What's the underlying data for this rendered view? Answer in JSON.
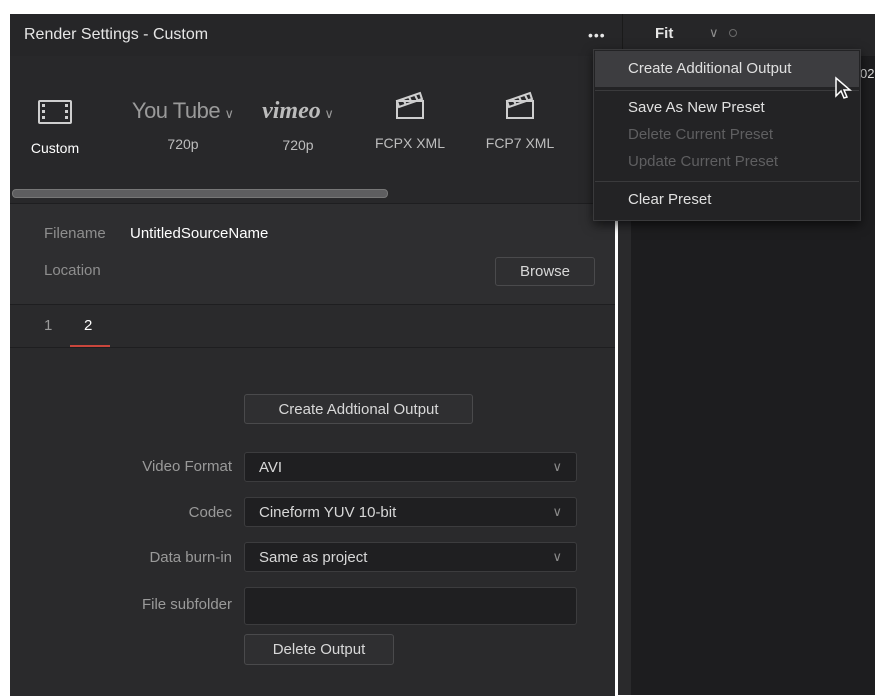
{
  "window": {
    "title": "Render Settings - Custom"
  },
  "titlebar": {
    "more_label": "•••",
    "fit_label": "Fit",
    "fit_chevron": "∨",
    "edge_text": "02"
  },
  "presets": [
    {
      "id": "custom",
      "label": "Custom",
      "icon": "film-icon"
    },
    {
      "id": "youtube",
      "brand_left": "You",
      "brand_right": "Tube",
      "label": "720p",
      "icon": "youtube-logo"
    },
    {
      "id": "vimeo",
      "brand": "vimeo",
      "label": "720p",
      "icon": "vimeo-logo"
    },
    {
      "id": "fcpx",
      "label": "FCPX XML",
      "icon": "clapperboard-icon"
    },
    {
      "id": "fcp7",
      "label": "FCP7 XML",
      "icon": "clapperboard-icon"
    }
  ],
  "file": {
    "filename_label": "Filename",
    "filename_value": "UntitledSourceName",
    "location_label": "Location",
    "browse_label": "Browse"
  },
  "tabs": [
    "1",
    "2"
  ],
  "form": {
    "create_button": "Create Addtional Output",
    "video_format_label": "Video Format",
    "video_format_value": "AVI",
    "codec_label": "Codec",
    "codec_value": "Cineform YUV 10-bit",
    "burnin_label": "Data burn-in",
    "burnin_value": "Same as project",
    "subfolder_label": "File subfolder",
    "subfolder_value": "",
    "delete_button": "Delete Output"
  },
  "menu": {
    "items": [
      {
        "label": "Create Additional Output",
        "enabled": true
      },
      {
        "label": "Save As New Preset",
        "enabled": true
      },
      {
        "label": "Delete Current Preset",
        "enabled": false
      },
      {
        "label": "Update Current Preset",
        "enabled": false
      },
      {
        "label": "Clear Preset",
        "enabled": true
      }
    ]
  },
  "colors": {
    "accent": "#c9463c",
    "panel": "#2a2a2c",
    "menu": "#232325"
  }
}
